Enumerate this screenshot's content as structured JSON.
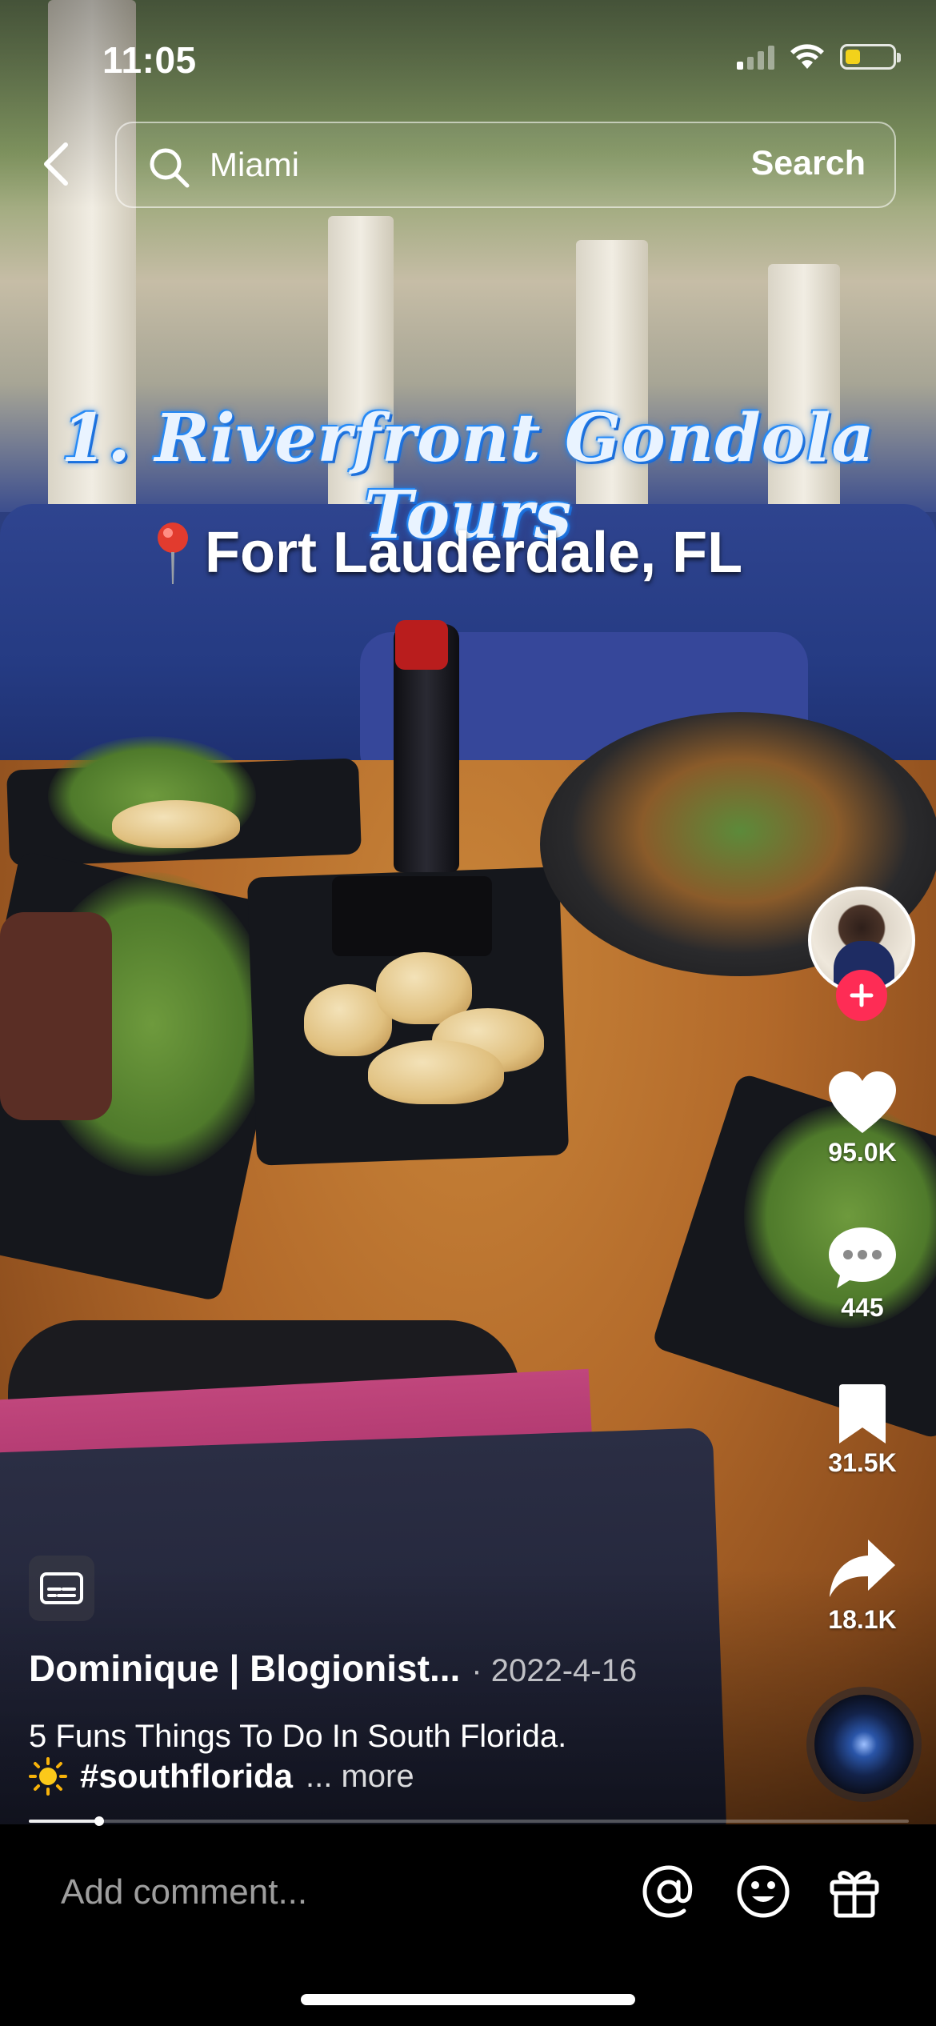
{
  "status_bar": {
    "time": "11:05",
    "battery_color": "#f2d21b"
  },
  "search": {
    "query": "Miami",
    "button_label": "Search"
  },
  "overlay": {
    "title_caption": "1. Riverfront Gondola Tours",
    "location_caption": "Fort Lauderdale, FL"
  },
  "actions": {
    "likes": "95.0K",
    "comments": "445",
    "saves": "31.5K",
    "shares": "18.1K"
  },
  "post": {
    "author": "Dominique | Blogionist...",
    "date": "· 2022-4-16",
    "description": "5 Funs Things To Do In South Florida.",
    "hashtag": "#southflorida",
    "more_label": "... more",
    "progress": 0.08
  },
  "comment_bar": {
    "placeholder": "Add comment..."
  },
  "colors": {
    "accent": "#fe2c55",
    "caption_glow": "#2a8df5"
  },
  "icons": [
    "back-arrow-icon",
    "search-icon",
    "pin-icon",
    "plus-icon",
    "heart-icon",
    "comment-bubble-icon",
    "bookmark-icon",
    "share-arrow-icon",
    "captions-icon",
    "sun-emoji-icon",
    "at-mention-icon",
    "emoji-icon",
    "gift-icon"
  ]
}
